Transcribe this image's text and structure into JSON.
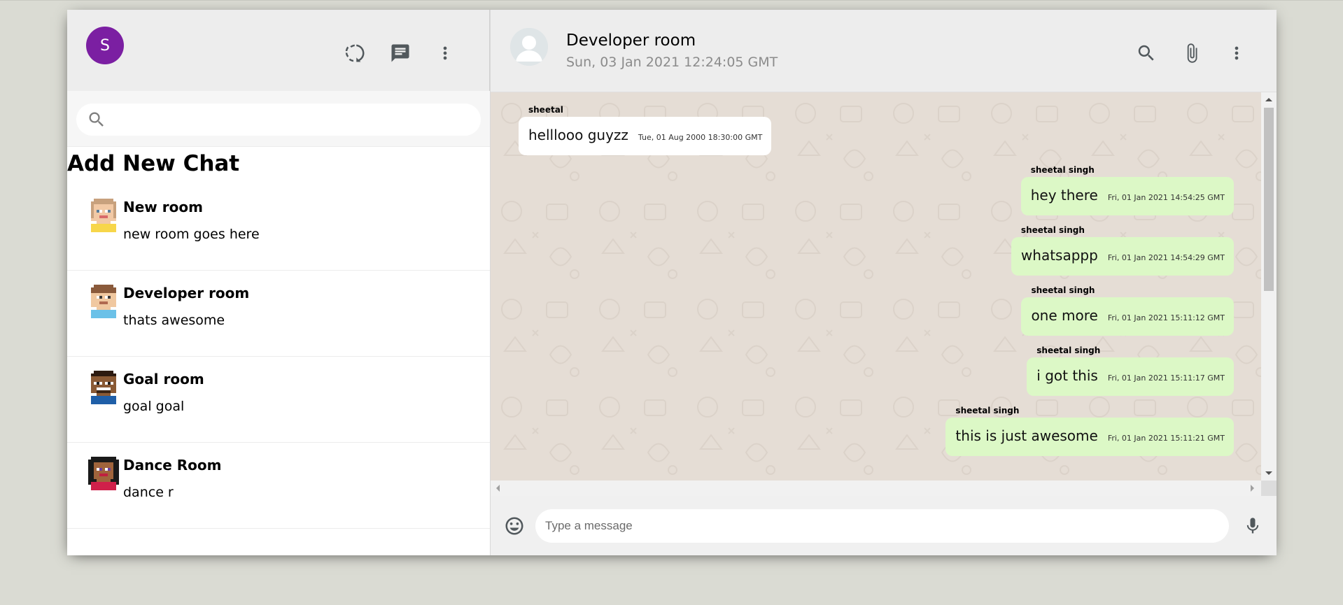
{
  "sidebar": {
    "avatar_letter": "S",
    "avatar_color": "#7b1fa2",
    "header_icons": [
      "status-icon",
      "chat-icon",
      "more-vert-icon"
    ],
    "search": {
      "placeholder": "",
      "icon": "search-icon"
    },
    "add_new_chat_label": "Add New Chat",
    "chats": [
      {
        "name": "New room",
        "last_message": "new room goes here"
      },
      {
        "name": "Developer room",
        "last_message": "thats awesome"
      },
      {
        "name": "Goal room",
        "last_message": "goal goal"
      },
      {
        "name": "Dance Room",
        "last_message": "dance r"
      }
    ]
  },
  "chat": {
    "title": "Developer room",
    "last_seen": "Sun, 03 Jan 2021 12:24:05 GMT",
    "header_icons": [
      "search-icon",
      "attach-icon",
      "more-vert-icon"
    ],
    "messages": [
      {
        "author": "sheetal",
        "text": "helllooo guyzz",
        "time": "Tue, 01 Aug 2000 18:30:00 GMT",
        "side": "left"
      },
      {
        "author": "sheetal singh",
        "text": "hey there",
        "time": "Fri, 01 Jan 2021 14:54:25 GMT",
        "side": "right"
      },
      {
        "author": "sheetal singh",
        "text": "whatsappp",
        "time": "Fri, 01 Jan 2021 14:54:29 GMT",
        "side": "right"
      },
      {
        "author": "sheetal singh",
        "text": "one more",
        "time": "Fri, 01 Jan 2021 15:11:12 GMT",
        "side": "right"
      },
      {
        "author": "sheetal singh",
        "text": "i got this",
        "time": "Fri, 01 Jan 2021 15:11:17 GMT",
        "side": "right"
      },
      {
        "author": "sheetal singh",
        "text": "this is just awesome",
        "time": "Fri, 01 Jan 2021 15:11:21 GMT",
        "side": "right"
      }
    ],
    "footer": {
      "input_placeholder": "Type a message",
      "emoji_icon": "emoji-icon",
      "mic_icon": "mic-icon"
    },
    "colors": {
      "sent_bubble": "#dcf8c6",
      "received_bubble": "#ffffff",
      "background": "#e5ddd5"
    }
  }
}
